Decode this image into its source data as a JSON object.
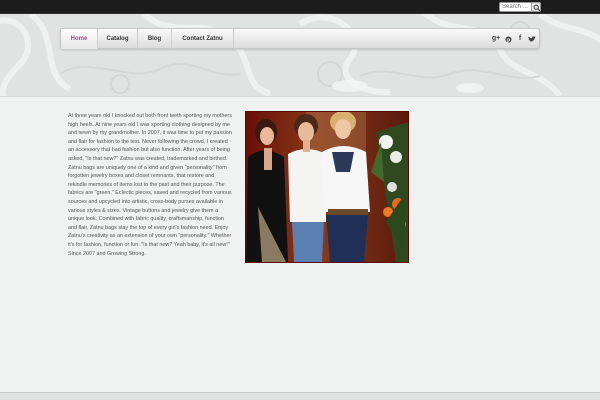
{
  "search": {
    "placeholder": "Search ..."
  },
  "nav": {
    "items": [
      {
        "label": "Home",
        "active": true
      },
      {
        "label": "Catalog",
        "active": false
      },
      {
        "label": "Blog",
        "active": false
      },
      {
        "label": "Contact Zatnu",
        "active": false
      }
    ],
    "social_icons": [
      "google-plus-icon",
      "pinterest-icon",
      "facebook-icon",
      "twitter-icon"
    ],
    "active_color": "#a0518c"
  },
  "content": {
    "paragraph": "At three years old I knocked out both front teeth sporting my mothers high heels. At nine years old I was sporting clothing designed by me and sewn by my grandmother. In 2007, it was time to put my passion and flair for fashion to the test. Never following the crowd, I created an accessory that had fashion but also function. After years of being asked, \"Is that new?\" Zatnu was created, trademarked and birthed. Zatnu bags are uniquely one of a kind and given \"personality\" from forgotten jewelry boxes and closet remnants, that restore and rekindle memories of items lost to the past and their purpose. The fabrics are \"green.\" Eclectic pieces, saved and recycled from various sources and upcycled into artistic, cross-body purses available in various styles & sizes. Vintage buttons and jewelry give them a unique look. Combined with fabric quality, craftsmanship, function and flair, Zatnu bags stay the top of every girl's fashion need. Enjoy Zatnu's creativity as an extension of your own \"personality.\" Whether it's for fashion, function or fun. \"Is that new? Yeah baby, it's all new!\" Since 2007 and Growing Strong."
  }
}
